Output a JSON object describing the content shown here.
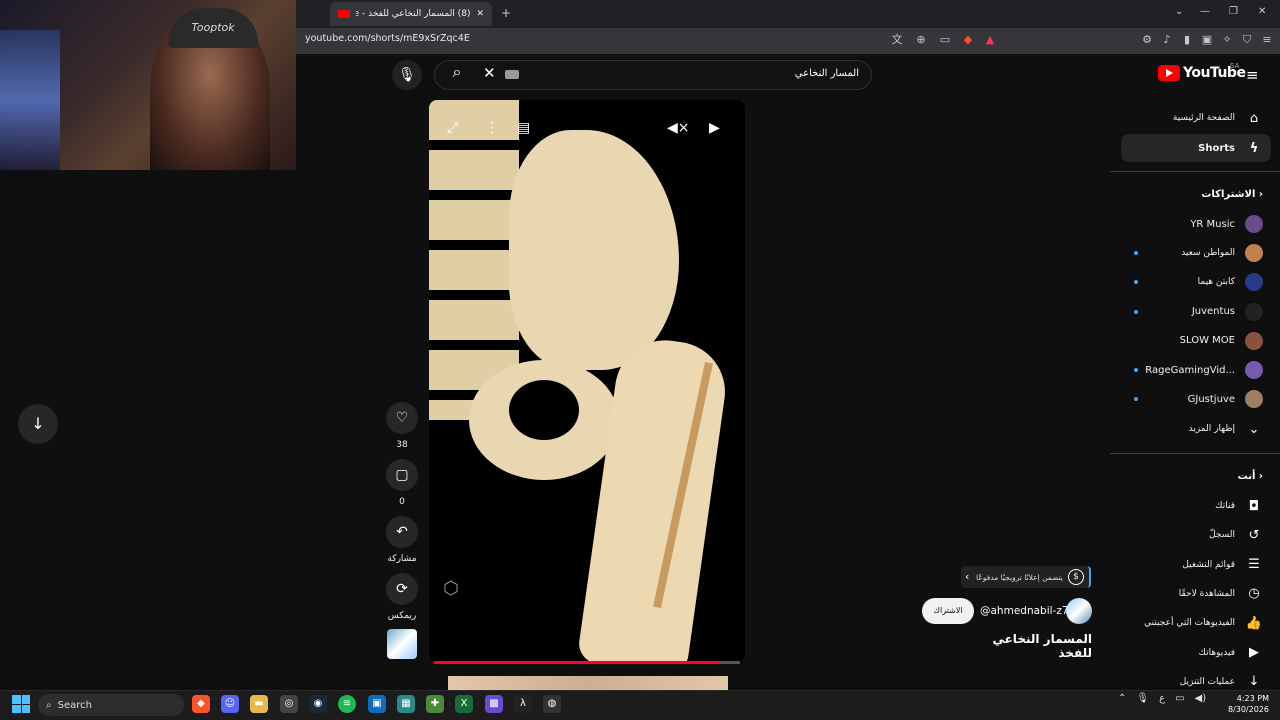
{
  "browser": {
    "tab_title": "(8) المسمار النخاعي للفخذ - YouTube",
    "url": "youtube.com/shorts/mE9xSrZqc4E"
  },
  "webcam": {
    "cap_text": "Tooptok"
  },
  "search": {
    "query": "المسار النخاعي"
  },
  "actions": {
    "like_count": "38",
    "comment_count": "0",
    "share_label": "مشاركة",
    "remix_label": "ريمكس"
  },
  "video": {
    "progress_fraction": 0.93,
    "promo_text": "يتضمن إعلانًا ترويجيًا مدفوعًا",
    "channel_handle": "@ahmednabil-z7r",
    "subscribe_label": "الاشتراك",
    "title": "المسمار النخاعي للفخذ"
  },
  "sidebar": {
    "logo_text": "YouTube",
    "region": "SA",
    "nav": [
      {
        "label": "الصفحة الرئيسية",
        "icon": "home-icon"
      },
      {
        "label": "Shorts",
        "icon": "shorts-icon",
        "active": true
      }
    ],
    "subscriptions_header": "الاشتراكات",
    "subscriptions": [
      {
        "name": "YR Music",
        "dot": false,
        "color": "#6a4a8a"
      },
      {
        "name": "المواطن سعيد",
        "dot": true,
        "color": "#c08050"
      },
      {
        "name": "كابتن هيما",
        "dot": true,
        "color": "#2a3a8a"
      },
      {
        "name": "Juventus",
        "dot": true,
        "color": "#222222"
      },
      {
        "name": "SLOW MOE",
        "dot": false,
        "color": "#8a5040"
      },
      {
        "name": "RageGamingVid...",
        "dot": true,
        "color": "#7a5ab0"
      },
      {
        "name": "GJustjuve",
        "dot": true,
        "color": "#a08060"
      }
    ],
    "show_more_label": "إظهار المزيد",
    "you_header": "أنت",
    "you_items": [
      {
        "label": "قناتك",
        "icon": "user-icon"
      },
      {
        "label": "السجلّ",
        "icon": "history-icon"
      },
      {
        "label": "قوائم التشغيل",
        "icon": "playlist-icon"
      },
      {
        "label": "المشاهدة لاحقًا",
        "icon": "clock-icon"
      },
      {
        "label": "الفيديوهات التي أعجبتني",
        "icon": "like-icon"
      },
      {
        "label": "فيديوهاتك",
        "icon": "video-icon"
      },
      {
        "label": "عمليات التنزيل",
        "icon": "download-icon"
      }
    ]
  },
  "taskbar": {
    "search_placeholder": "Search",
    "time": "4:23 PM",
    "date": "8/30/2026",
    "lang": "ع"
  }
}
